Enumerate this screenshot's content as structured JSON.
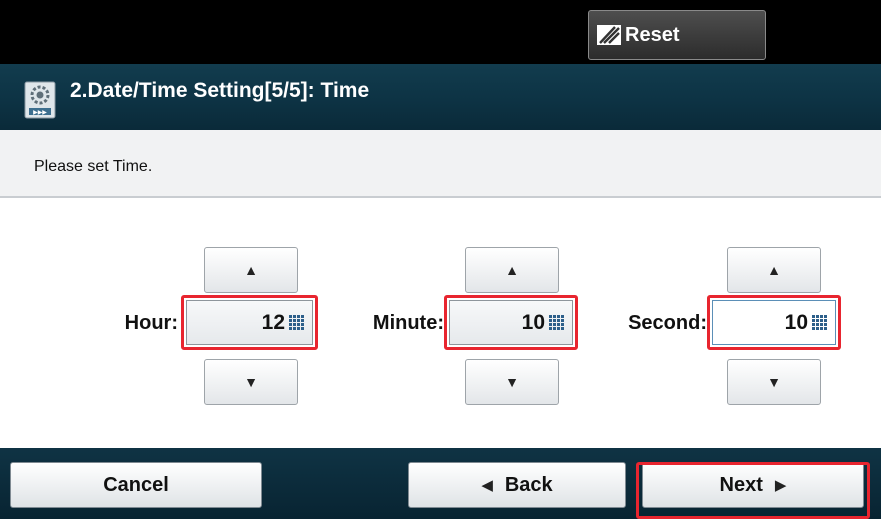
{
  "topbar": {
    "reset_label": "Reset"
  },
  "title": {
    "text": "2.Date/Time Setting[5/5]: Time"
  },
  "message": {
    "text": "Please set Time."
  },
  "fields": {
    "hour": {
      "label": "Hour:",
      "value": "12"
    },
    "minute": {
      "label": "Minute:",
      "value": "10"
    },
    "second": {
      "label": "Second:",
      "value": "10"
    }
  },
  "arrows": {
    "up": "▲",
    "down": "▼"
  },
  "buttons": {
    "cancel_label": "Cancel",
    "back_label": "Back",
    "next_label": "Next",
    "back_arrow": "◀",
    "next_arrow": "▶"
  },
  "colors": {
    "title_bar": "#0d3344",
    "highlight": "#e8252f",
    "top_bar": "#000000"
  },
  "icons": {
    "reset": "eraser-icon",
    "title": "settings-gear-icon",
    "keypad": "keypad-icon"
  }
}
